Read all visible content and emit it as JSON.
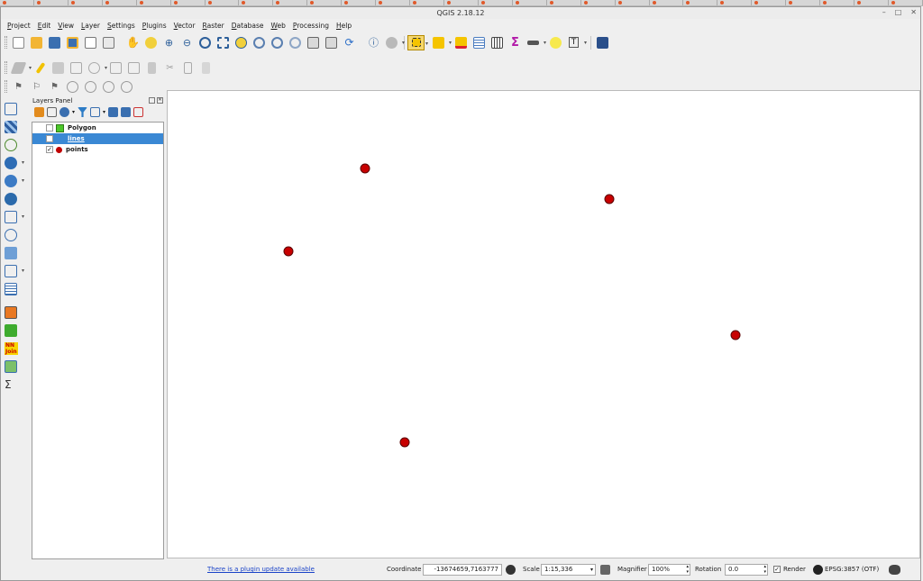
{
  "window": {
    "title": "QGIS 2.18.12"
  },
  "menu": [
    "Project",
    "Edit",
    "View",
    "Layer",
    "Settings",
    "Plugins",
    "Vector",
    "Raster",
    "Database",
    "Web",
    "Processing",
    "Help"
  ],
  "layers_panel": {
    "title": "Layers Panel",
    "layers": [
      {
        "name": "Polygon",
        "checked": false,
        "symbol": "polygon-fill",
        "color": "#4cc72a",
        "selected": false
      },
      {
        "name": "lines",
        "checked": false,
        "symbol": "line",
        "color": "#3a88d4",
        "selected": true
      },
      {
        "name": "points",
        "checked": true,
        "symbol": "point",
        "color": "#c00000",
        "selected": false
      }
    ]
  },
  "map": {
    "point_color": "#c80000",
    "point_stroke": "#5a0000"
  },
  "statusbar": {
    "update_link": "There is a plugin update available",
    "coordinate_label": "Coordinate",
    "coordinate_value": "-13674659,7163777",
    "scale_label": "Scale",
    "scale_value": "1:15,336",
    "magnifier_label": "Magnifier",
    "magnifier_value": "100%",
    "rotation_label": "Rotation",
    "rotation_value": "0.0",
    "render_label": "Render",
    "render_checked": true,
    "crs": "EPSG:3857 (OTF)"
  }
}
